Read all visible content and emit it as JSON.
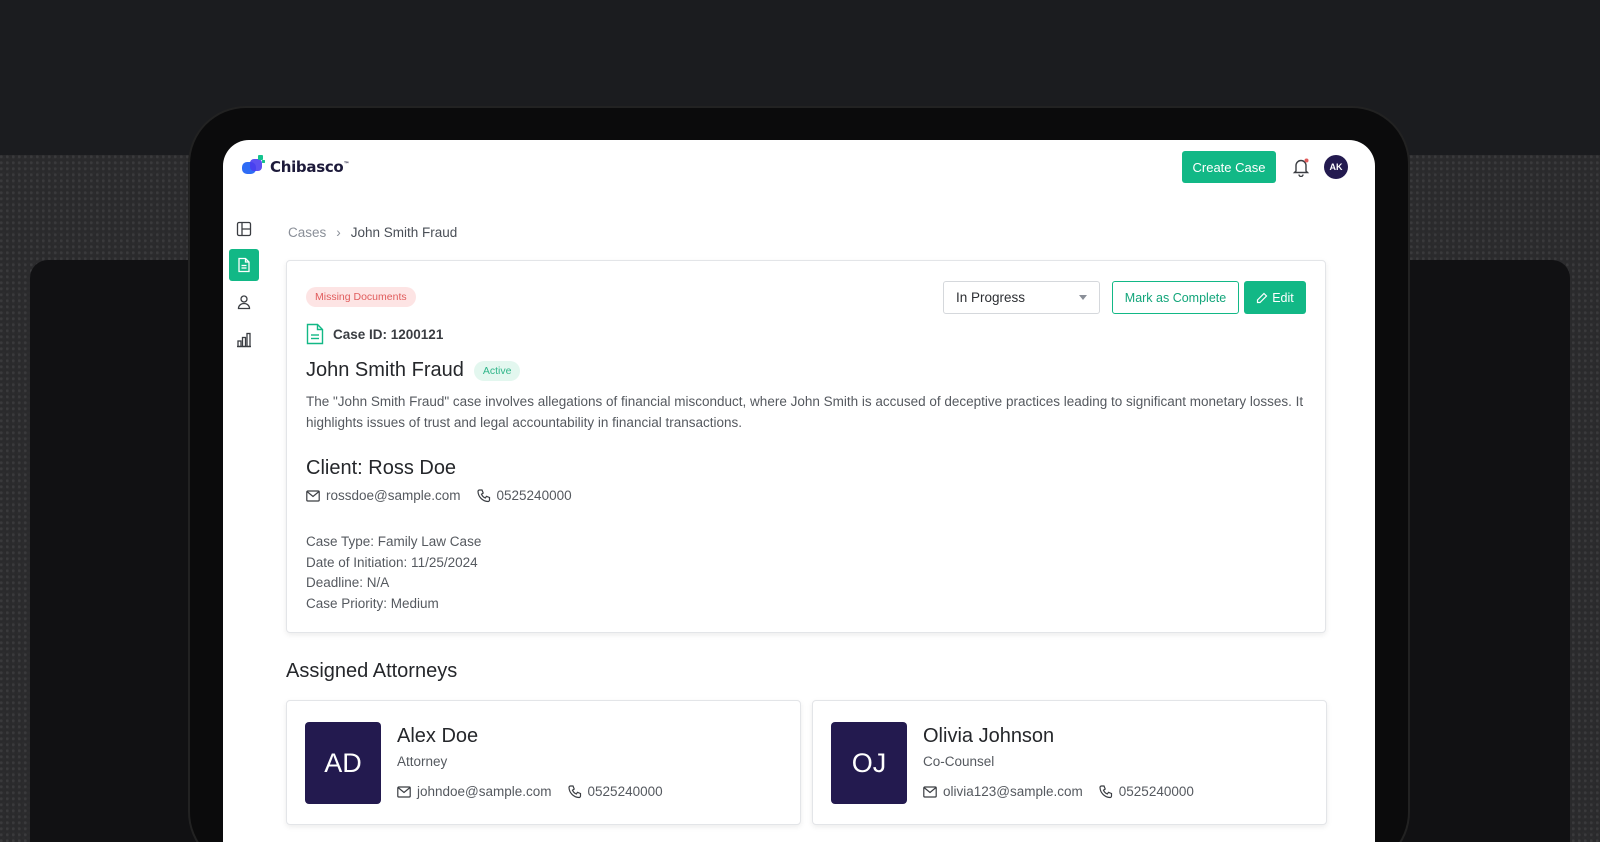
{
  "app": {
    "name": "Chibasco",
    "trademark": "™"
  },
  "header": {
    "create_case_label": "Create Case",
    "user_initials": "AK"
  },
  "sidebar": {
    "items": [
      {
        "name": "dashboard",
        "icon": "layout-icon",
        "active": false
      },
      {
        "name": "cases",
        "icon": "document-icon",
        "active": true
      },
      {
        "name": "clients",
        "icon": "user-icon",
        "active": false
      },
      {
        "name": "reports",
        "icon": "bar-chart-icon",
        "active": false
      }
    ]
  },
  "breadcrumb": {
    "parent": "Cases",
    "separator": "›",
    "current": "John Smith Fraud"
  },
  "case": {
    "missing_badge": "Missing Documents",
    "status_value": "In Progress",
    "mark_complete_label": "Mark as Complete",
    "edit_label": "Edit",
    "case_id_label": "Case ID: 1200121",
    "title": "John Smith Fraud",
    "active_badge": "Active",
    "description": "The \"John Smith Fraud\" case involves allegations of financial misconduct, where John Smith is accused of deceptive practices leading to significant monetary losses. It highlights issues of trust and legal accountability in financial transactions.",
    "client": {
      "heading": "Client: Ross Doe",
      "email": "rossdoe@sample.com",
      "phone": "0525240000"
    },
    "details": {
      "case_type": "Case Type: Family Law Case",
      "date_of_initiation": "Date of Initiation: 11/25/2024",
      "deadline": "Deadline: N/A",
      "priority": "Case Priority: Medium"
    }
  },
  "attorneys": {
    "heading": "Assigned Attorneys",
    "items": [
      {
        "initials": "AD",
        "name": "Alex Doe",
        "role": "Attorney",
        "email": "johndoe@sample.com",
        "phone": "0525240000"
      },
      {
        "initials": "OJ",
        "name": "Olivia Johnson",
        "role": "Co-Counsel",
        "email": "olivia123@sample.com",
        "phone": "0525240000"
      }
    ]
  },
  "colors": {
    "accent": "#12b886",
    "avatar_bg": "#231a4f",
    "danger_badge_bg": "#fde4e4",
    "success_badge_bg": "#e3f7ef"
  }
}
